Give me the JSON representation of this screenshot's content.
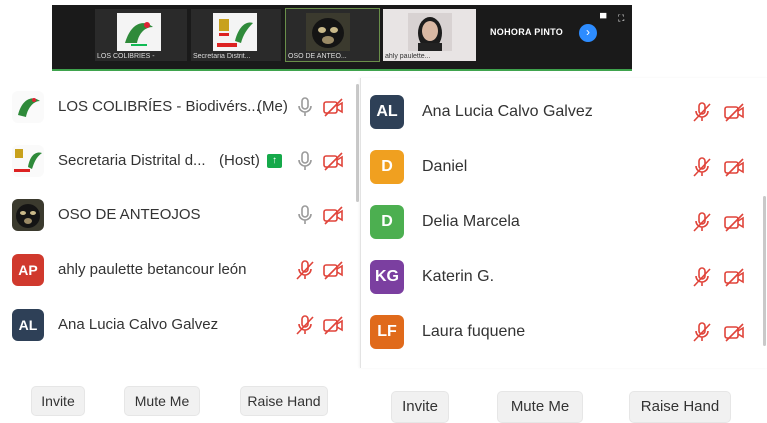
{
  "video_strip": {
    "thumbs": [
      {
        "caption": "LOS COLIBRÍES -"
      },
      {
        "caption": "Secretaria Distrit..."
      },
      {
        "caption": "OSO DE ANTEO..."
      },
      {
        "caption": "ahly paulette..."
      }
    ],
    "speaker_name": "NOHORA PINTO",
    "next_icon": "chevron-right-icon"
  },
  "left_panel": {
    "participants": [
      {
        "name": "LOS COLIBRÍES - Biodivérs...",
        "tag": "(Me)",
        "avatar_type": "image",
        "mic": "on",
        "video": "off"
      },
      {
        "name": "Secretaria Distrital d...",
        "tag": "(Host)",
        "avatar_type": "image",
        "mic": "on",
        "video": "off"
      },
      {
        "name": "OSO DE ANTEOJOS",
        "tag": "",
        "avatar_type": "image",
        "mic": "on",
        "video": "off"
      },
      {
        "name": "ahly paulette betancour león",
        "initials": "AP",
        "color": "#d0392d",
        "mic": "muted",
        "video": "off"
      },
      {
        "name": "Ana Lucia Calvo Galvez",
        "initials": "AL",
        "color": "#2e4057",
        "mic": "muted",
        "video": "off"
      }
    ],
    "buttons": {
      "invite": "Invite",
      "mute_me": "Mute Me",
      "raise_hand": "Raise Hand"
    }
  },
  "right_panel": {
    "participants": [
      {
        "name": "Ana Lucia Calvo Galvez",
        "initials": "AL",
        "color": "#2e4057"
      },
      {
        "name": "Daniel",
        "initials": "D",
        "color": "#f0a020"
      },
      {
        "name": "Delia Marcela",
        "initials": "D",
        "color": "#4caf50"
      },
      {
        "name": "Katerin G.",
        "initials": "KG",
        "color": "#7b3fa0"
      },
      {
        "name": "Laura fuquene",
        "initials": "LF",
        "color": "#e06a1b"
      }
    ],
    "buttons": {
      "invite": "Invite",
      "mute_me": "Mute Me",
      "raise_hand": "Raise Hand"
    }
  },
  "colors": {
    "muted_red": "#e0443a",
    "mic_gray": "#9a9a9a",
    "host_green": "#15a94a"
  }
}
